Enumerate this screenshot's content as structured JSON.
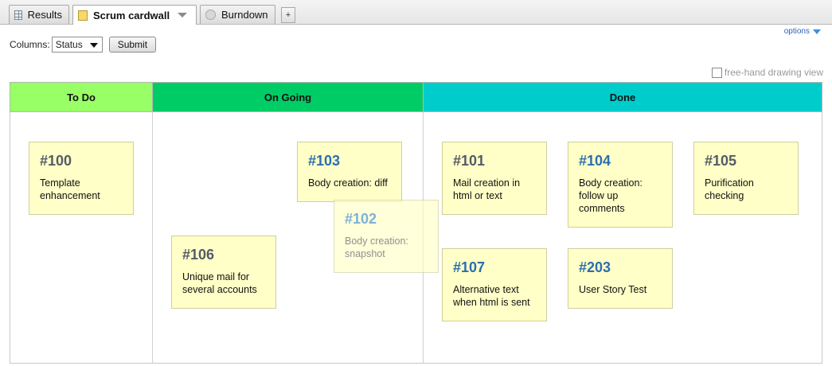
{
  "tabs": [
    {
      "label": "Results",
      "icon": "table-icon"
    },
    {
      "label": "Scrum cardwall",
      "icon": "note-icon"
    },
    {
      "label": "Burndown",
      "icon": "chart-icon"
    }
  ],
  "add_tab_label": "+",
  "options_label": "options",
  "columns_control": {
    "label": "Columns:",
    "selected": "Status",
    "submit_label": "Submit"
  },
  "freehand_label": "free-hand drawing view",
  "columns": [
    {
      "title": "To Do",
      "color": "#99ff66"
    },
    {
      "title": "On Going",
      "color": "#00cc66"
    },
    {
      "title": "Done",
      "color": "#00cccc"
    }
  ],
  "cards": [
    {
      "id": "#100",
      "title": "Template enhancement"
    },
    {
      "id": "#106",
      "title": "Unique mail for several accounts"
    },
    {
      "id": "#103",
      "title": "Body creation: diff"
    },
    {
      "id": "#102",
      "title": "Body creation: snapshot"
    },
    {
      "id": "#101",
      "title": "Mail creation in html or text"
    },
    {
      "id": "#104",
      "title": "Body creation: follow up comments"
    },
    {
      "id": "#105",
      "title": "Purification checking"
    },
    {
      "id": "#107",
      "title": "Alternative text when html is sent"
    },
    {
      "id": "#203",
      "title": "User Story Test"
    }
  ]
}
